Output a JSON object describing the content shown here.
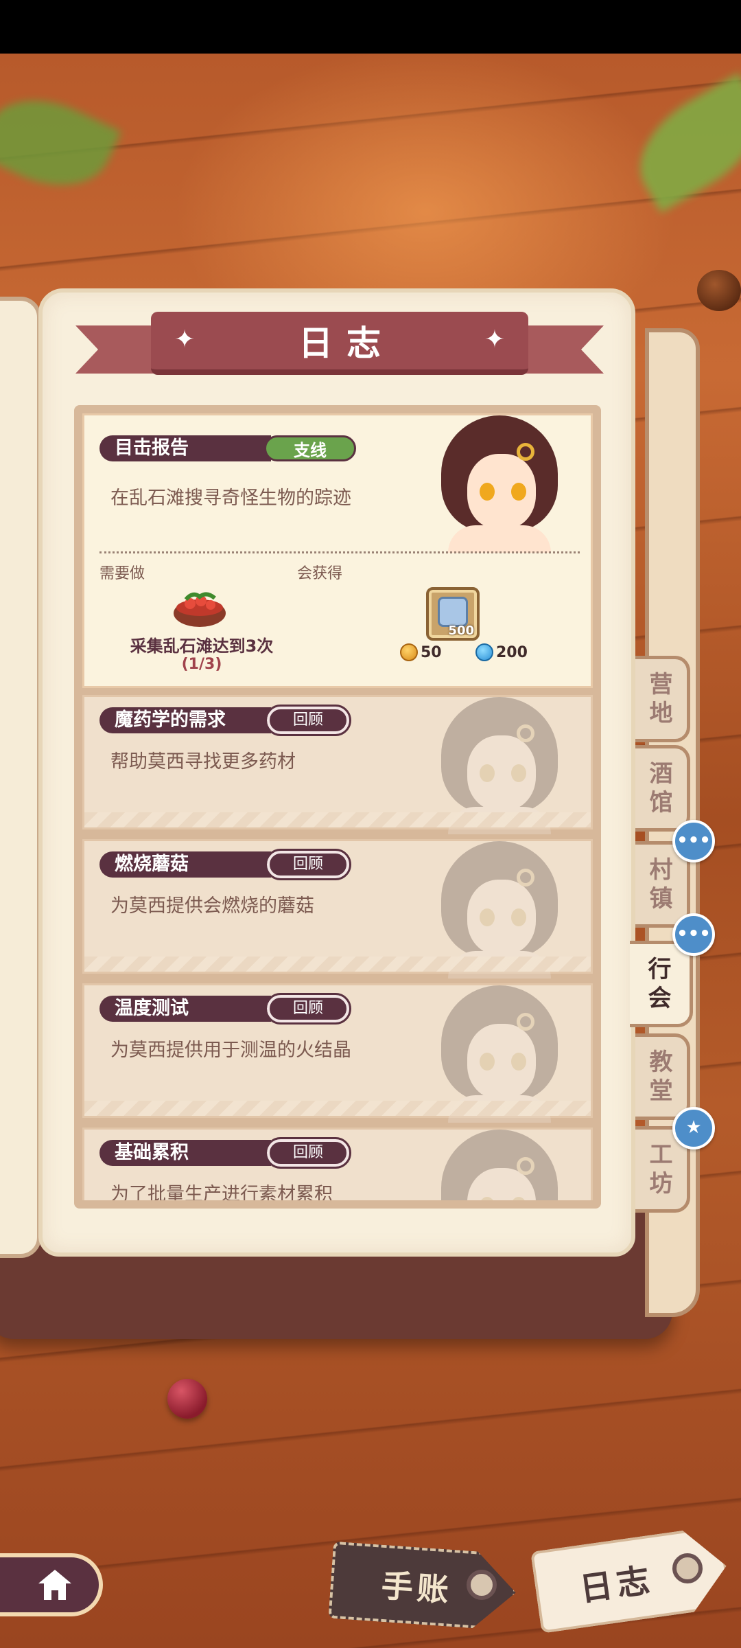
{
  "header": {
    "title": "日志"
  },
  "active_quest": {
    "title": "目击报告",
    "tag": "支线",
    "description": "在乱石滩搜寻奇怪生物的踪迹",
    "need_label": "需要做",
    "reward_label": "会获得",
    "need_text": "采集乱石滩达到3次",
    "progress": "(1/3)",
    "reward_item_count": "500",
    "reward_gold": "50",
    "reward_blue": "200"
  },
  "completed_quests": [
    {
      "title": "魔药学的需求",
      "tag": "回顾",
      "description": "帮助莫西寻找更多药材"
    },
    {
      "title": "燃烧蘑菇",
      "tag": "回顾",
      "description": "为莫西提供会燃烧的蘑菇"
    },
    {
      "title": "温度测试",
      "tag": "回顾",
      "description": "为莫西提供用于测温的火结晶"
    },
    {
      "title": "基础累积",
      "tag": "回顾",
      "description": "为了批量生产进行素材累积"
    }
  ],
  "tabs": [
    {
      "label": "营地",
      "active": false
    },
    {
      "label": "酒馆",
      "active": false
    },
    {
      "label": "村镇",
      "active": false
    },
    {
      "label": "行会",
      "active": true
    },
    {
      "label": "教堂",
      "active": false
    },
    {
      "label": "工坊",
      "active": false
    }
  ],
  "bottom": {
    "ledger_label": "手账",
    "journal_label": "日志"
  },
  "icons": {
    "home": "home-icon",
    "chat": "chat-bubble-icon",
    "star": "star-bubble-icon",
    "gold": "gold-coin-icon",
    "blue": "blue-gem-icon"
  },
  "colors": {
    "accent": "#9b4b50",
    "tag_branch": "#6aa34c",
    "dark_plum": "#5a3140"
  }
}
